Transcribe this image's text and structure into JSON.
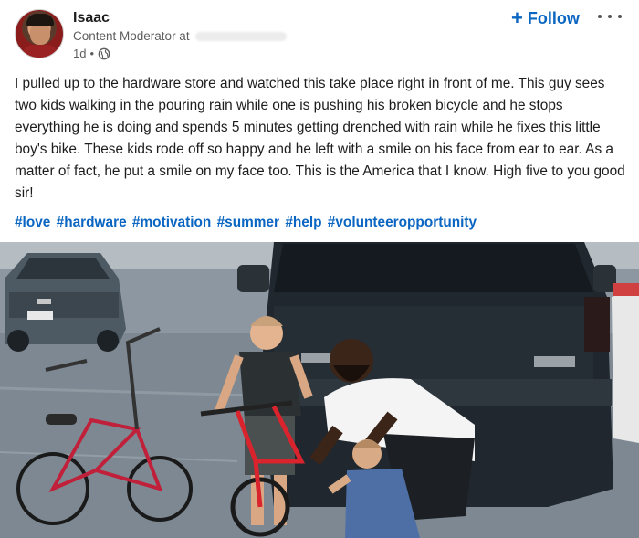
{
  "author": {
    "name": "Isaac",
    "headline": "Content Moderator at",
    "time": "1d",
    "separator": "•",
    "visibility_icon": "globe-icon"
  },
  "actions": {
    "follow_label": "Follow",
    "follow_icon": "plus-icon",
    "more_icon": "more-options-icon"
  },
  "post": {
    "text": "I pulled up to the hardware store and watched this take place right in front of me. This guy sees two kids walking in the pouring rain while one is pushing his broken bicycle and he stops everything he is doing and spends 5 minutes getting drenched with rain while he fixes this little boy's bike. These kids rode off so happy and he left with a smile on his face from ear to ear. As a matter of fact, he put a smile on my face too. This is the America that I know. High five to you good sir!",
    "hashtags": [
      "#love",
      "#hardware",
      "#motivation",
      "#summer",
      "#help",
      "#volunteeropportunity"
    ]
  },
  "colors": {
    "link_blue": "#0a66c2",
    "text": "#1d1d1d",
    "muted": "#5e5e5e"
  }
}
